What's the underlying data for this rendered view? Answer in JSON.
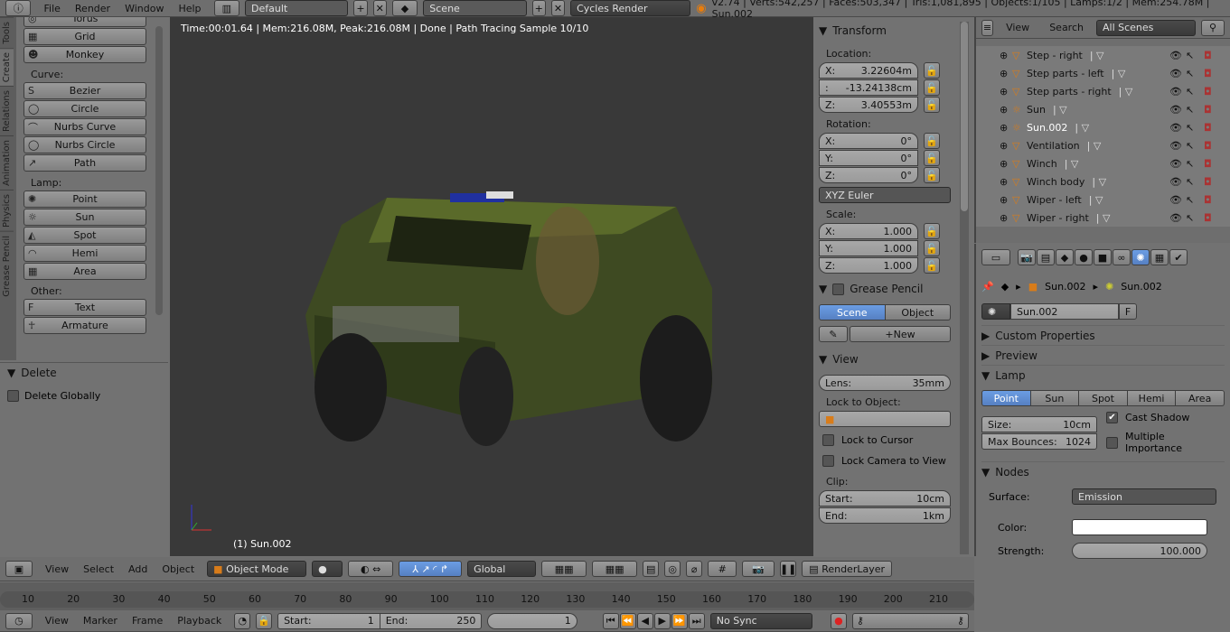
{
  "topbar": {
    "menus": [
      "File",
      "Render",
      "Window",
      "Help"
    ],
    "layout": "Default",
    "scene": "Scene",
    "engine": "Cycles Render",
    "stats": "v2.74 | Verts:542,257 | Faces:503,347 | Tris:1,081,895 | Objects:1/105 | Lamps:1/2 | Mem:254.78M | Sun.002"
  },
  "left_tabs": [
    "Tools",
    "Create",
    "Relations",
    "Animation",
    "Physics",
    "Grease Pencil"
  ],
  "toolshelf": {
    "partial": "Torus",
    "items1": [
      "Grid",
      "Monkey"
    ],
    "curve_label": "Curve:",
    "curve": [
      "Bezier",
      "Circle",
      "Nurbs Curve",
      "Nurbs Circle",
      "Path"
    ],
    "lamp_label": "Lamp:",
    "lamp": [
      "Point",
      "Sun",
      "Spot",
      "Hemi",
      "Area"
    ],
    "other_label": "Other:",
    "other": [
      "Text",
      "Armature"
    ],
    "delete_title": "Delete",
    "delete_globally": "Delete Globally"
  },
  "viewport": {
    "render_info": "Time:00:01.64 | Mem:216.08M, Peak:216.08M | Done | Path Tracing Sample 10/10",
    "object_label": "(1) Sun.002"
  },
  "npanel": {
    "transform": "Transform",
    "location": "Location:",
    "loc": [
      {
        "k": "X:",
        "v": "3.22604m"
      },
      {
        "k": ":",
        "v": "-13.24138cm"
      },
      {
        "k": "Z:",
        "v": "3.40553m"
      }
    ],
    "rotation": "Rotation:",
    "rot": [
      {
        "k": "X:",
        "v": "0°"
      },
      {
        "k": "Y:",
        "v": "0°"
      },
      {
        "k": "Z:",
        "v": "0°"
      }
    ],
    "rot_mode": "XYZ Euler",
    "scale": "Scale:",
    "scl": [
      {
        "k": "X:",
        "v": "1.000"
      },
      {
        "k": "Y:",
        "v": "1.000"
      },
      {
        "k": "Z:",
        "v": "1.000"
      }
    ],
    "grease_pencil": "Grease Pencil",
    "gp_scene": "Scene",
    "gp_object": "Object",
    "gp_new": "New",
    "view": "View",
    "lens_k": "Lens:",
    "lens_v": "35mm",
    "lock_obj": "Lock to Object:",
    "lock_cursor": "Lock to Cursor",
    "lock_cam": "Lock Camera to View",
    "clip": "Clip:",
    "clip_start_k": "Start:",
    "clip_start_v": "10cm",
    "clip_end_k": "End:",
    "clip_end_v": "1km"
  },
  "outliner": {
    "view": "View",
    "search": "Search",
    "filter": "All Scenes",
    "items": [
      "Step - right",
      "Step parts - left",
      "Step parts - right",
      "Sun",
      "Sun.002",
      "Ventilation",
      "Winch",
      "Winch body",
      "Wiper - left",
      "Wiper - right"
    ]
  },
  "properties": {
    "crumb1": "Sun.002",
    "crumb2": "Sun.002",
    "datablock": "Sun.002",
    "fake": "F",
    "custom_props": "Custom Properties",
    "preview": "Preview",
    "lamp": "Lamp",
    "lamp_types": [
      "Point",
      "Sun",
      "Spot",
      "Hemi",
      "Area"
    ],
    "lamp_selected": "Point",
    "size_k": "Size:",
    "size_v": "10cm",
    "bounces_k": "Max Bounces:",
    "bounces_v": "1024",
    "cast_shadow": "Cast Shadow",
    "multi_imp": "Multiple Importance",
    "nodes": "Nodes",
    "surface_k": "Surface:",
    "surface_v": "Emission",
    "color_k": "Color:",
    "color_v": "#ffffff",
    "strength_k": "Strength:",
    "strength_v": "100.000"
  },
  "view3d_header": {
    "menus": [
      "View",
      "Select",
      "Add",
      "Object"
    ],
    "mode": "Object Mode",
    "orientation": "Global",
    "render_layer": "RenderLayer"
  },
  "timeline": {
    "ticks": [
      "10",
      "20",
      "30",
      "40",
      "50",
      "60",
      "70",
      "80",
      "90",
      "100",
      "110",
      "120",
      "130",
      "140",
      "150",
      "160",
      "170",
      "180",
      "190",
      "200",
      "210"
    ],
    "menus": [
      "View",
      "Marker",
      "Frame",
      "Playback"
    ],
    "start_k": "Start:",
    "start_v": "1",
    "end_k": "End:",
    "end_v": "250",
    "current": "1",
    "sync": "No Sync"
  }
}
